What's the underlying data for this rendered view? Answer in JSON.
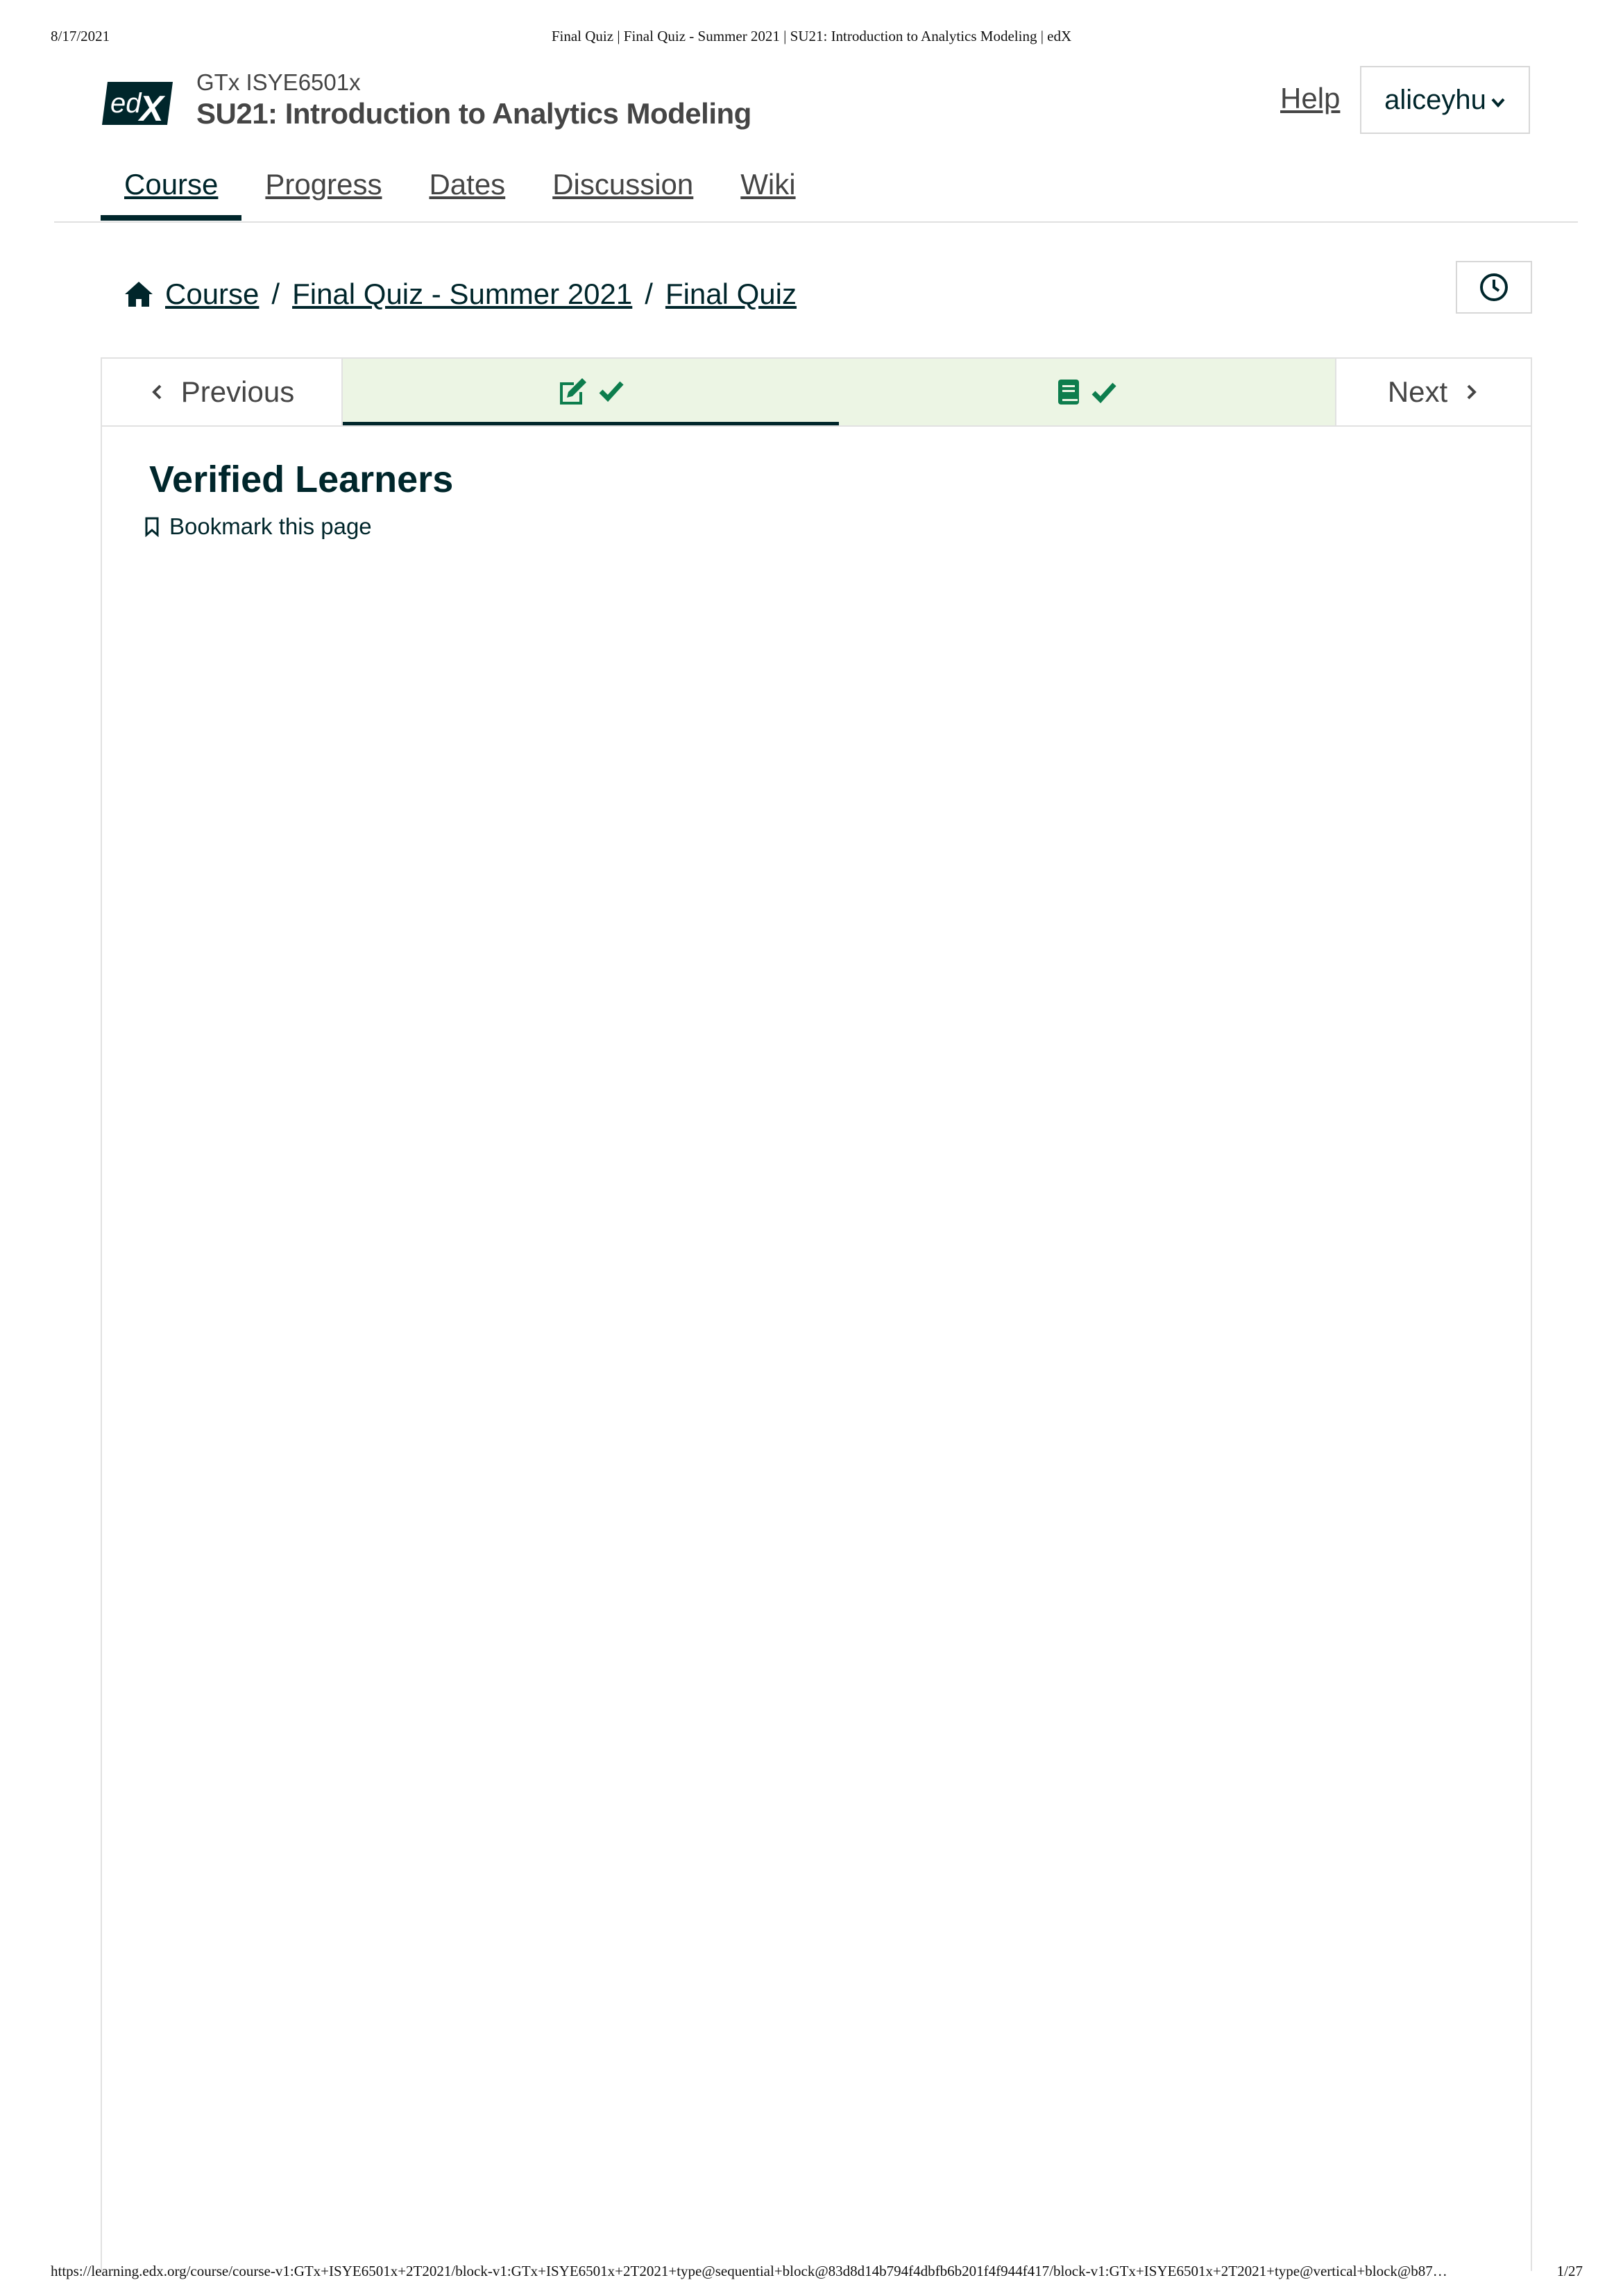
{
  "print": {
    "date": "8/17/2021",
    "document_title": "Final Quiz | Final Quiz - Summer 2021 | SU21: Introduction to Analytics Modeling | edX",
    "url": "https://learning.edx.org/course/course-v1:GTx+ISYE6501x+2T2021/block-v1:GTx+ISYE6501x+2T2021+type@sequential+block@83d8d14b794f4dbfb6b201f4f944f417/block-v1:GTx+ISYE6501x+2T2021+type@vertical+block@b87…",
    "page_number": "1/27"
  },
  "header": {
    "logo_text": "edX",
    "course_org": "GTx ISYE6501x",
    "course_title": "SU21: Introduction to Analytics Modeling",
    "help_label": "Help",
    "username": "aliceyhu"
  },
  "tabs": [
    {
      "label": "Course",
      "active": true
    },
    {
      "label": "Progress",
      "active": false
    },
    {
      "label": "Dates",
      "active": false
    },
    {
      "label": "Discussion",
      "active": false
    },
    {
      "label": "Wiki",
      "active": false
    }
  ],
  "breadcrumb": [
    "Course",
    "Final Quiz - Summer 2021",
    "Final Quiz"
  ],
  "sequence_nav": {
    "previous_label": "Previous",
    "next_label": "Next",
    "units": [
      {
        "icon": "edit-icon",
        "status": "check-icon",
        "active": true
      },
      {
        "icon": "book-icon",
        "status": "check-icon",
        "active": false
      }
    ]
  },
  "content": {
    "unit_title": "Verified Learners",
    "bookmark_label": "Bookmark this page"
  },
  "colors": {
    "primary": "#00262b",
    "muted_text": "#454545",
    "unit_bg": "#ecf5e4",
    "success_green": "#0d7d4d",
    "border": "#e1e1e1"
  }
}
